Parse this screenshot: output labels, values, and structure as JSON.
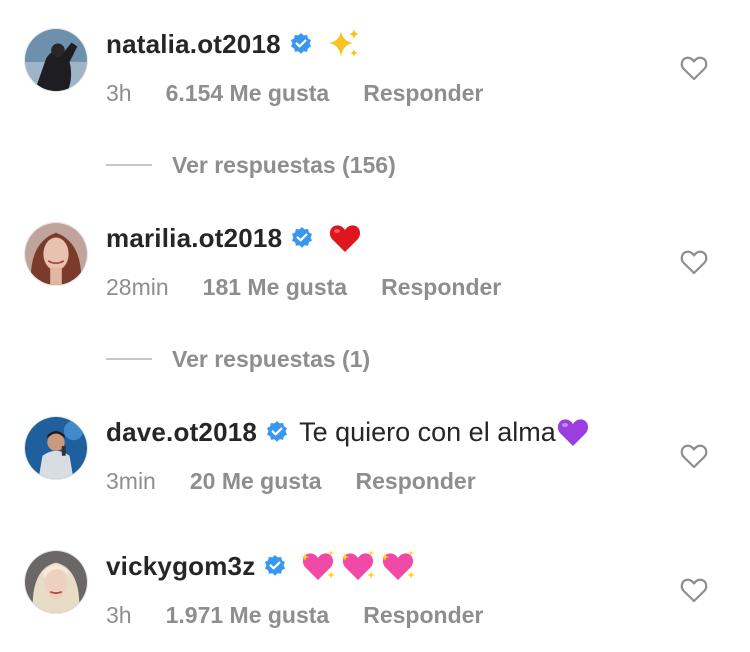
{
  "comments": [
    {
      "username": "natalia.ot2018",
      "verified": true,
      "text": "",
      "emoji": [
        "sparkles"
      ],
      "time": "3h",
      "likes": "6.154 Me gusta",
      "reply": "Responder",
      "view_replies": "Ver respuestas (156)"
    },
    {
      "username": "marilia.ot2018",
      "verified": true,
      "text": "",
      "emoji": [
        "red-heart"
      ],
      "time": "28min",
      "likes": "181 Me gusta",
      "reply": "Responder",
      "view_replies": "Ver respuestas (1)"
    },
    {
      "username": "dave.ot2018",
      "verified": true,
      "text": "Te quiero con el alma",
      "emoji": [
        "purple-heart"
      ],
      "time": "3min",
      "likes": "20 Me gusta",
      "reply": "Responder",
      "view_replies": ""
    },
    {
      "username": "vickygom3z",
      "verified": true,
      "text": "",
      "emoji": [
        "sparkling-heart",
        "sparkling-heart",
        "sparkling-heart"
      ],
      "time": "3h",
      "likes": "1.971 Me gusta",
      "reply": "Responder",
      "view_replies": ""
    }
  ],
  "colors": {
    "text": "#262626",
    "muted": "#8e8e8e",
    "verified": "#3897f0",
    "divider": "#c7c7c7"
  }
}
